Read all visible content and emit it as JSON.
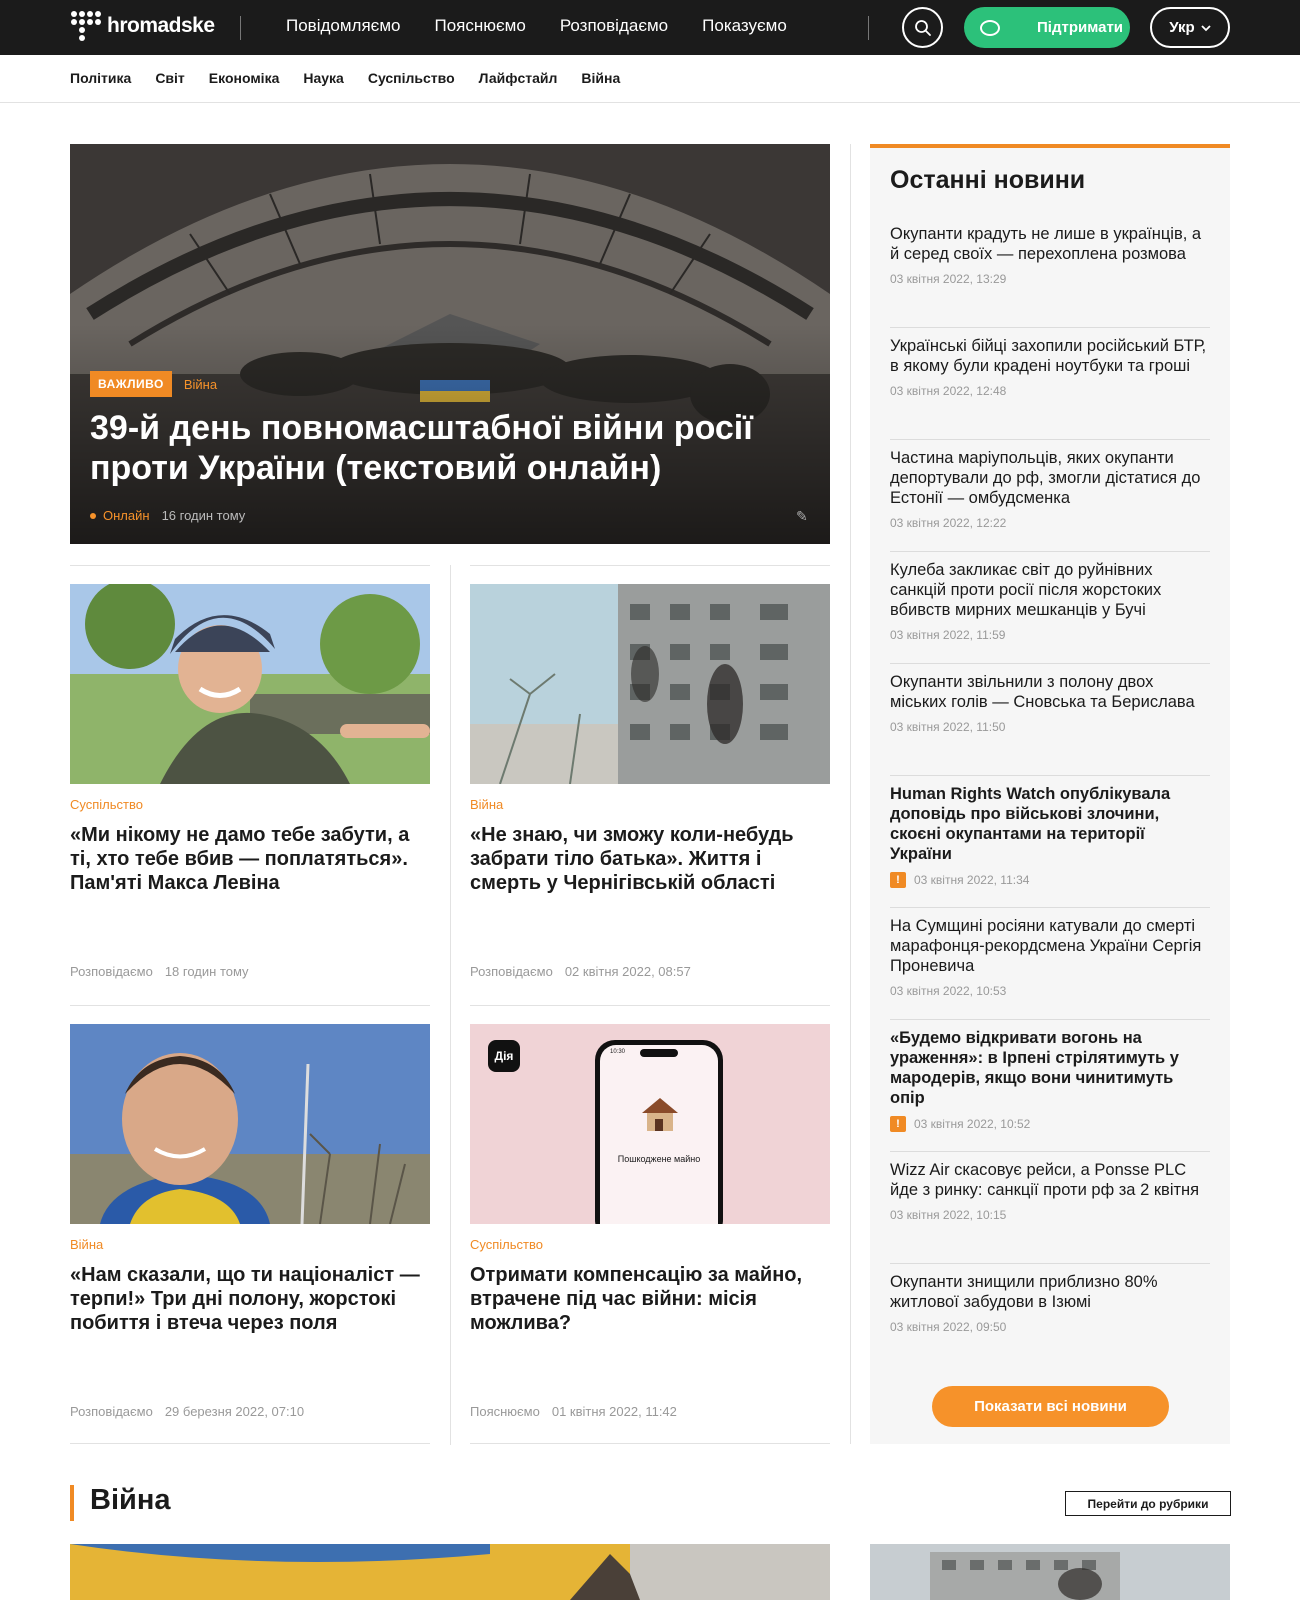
{
  "header": {
    "logo_text": "hromadske",
    "nav": [
      "Повідомляємо",
      "Пояснюємо",
      "Розповідаємо",
      "Показуємо"
    ],
    "support_label": "Підтримати",
    "lang_label": "Укр"
  },
  "subnav": [
    "Політика",
    "Світ",
    "Економіка",
    "Наука",
    "Суспільство",
    "Лайфстайл",
    "Війна"
  ],
  "hero": {
    "badge": "ВАЖЛИВО",
    "category": "Війна",
    "title": "39-й день повномасштабної війни росії проти України (текстовий онлайн)",
    "live_label": "Онлайн",
    "time": "16 годин тому"
  },
  "cards": [
    {
      "category": "Суспільство",
      "title": "«Ми нікому не дамо тебе забути, а ті, хто тебе вбив — поплатяться». Пам'яті Макса Левіна",
      "section": "Розповідаємо",
      "time": "18 годин тому"
    },
    {
      "category": "Війна",
      "title": "«Не знаю, чи зможу коли-небудь забрати тіло батька». Життя і смерть у Чернігівській області",
      "section": "Розповідаємо",
      "time": "02 квітня 2022, 08:57"
    },
    {
      "category": "Війна",
      "title": "«Нам сказали, що ти націоналіст — терпи!» Три дні полону, жорстокі побиття і втеча через поля",
      "section": "Розповідаємо",
      "time": "29 березня 2022, 07:10"
    },
    {
      "category": "Суспільство",
      "title": "Отримати компенсацію за майно, втрачене під час війни: місія можлива?",
      "section": "Пояснюємо",
      "time": "01 квітня 2022, 11:42"
    }
  ],
  "diia": {
    "app_label": "Дія",
    "screen_text": "Пошкоджене майно",
    "phone_time": "10:30"
  },
  "sidebar": {
    "title": "Останні новини",
    "items": [
      {
        "title": "Окупанти крадуть не лише в українців, а й серед своїх — перехоплена розмова",
        "date": "03 квітня 2022, 13:29",
        "bold": false,
        "important": false
      },
      {
        "title": "Українські бійці захопили російський БТР, в якому були крадені ноутбуки та гроші",
        "date": "03 квітня 2022, 12:48",
        "bold": false,
        "important": false
      },
      {
        "title": "Частина маріупольців, яких окупанти депортували до рф, змогли дістатися до Естонії — омбудсменка",
        "date": "03 квітня 2022, 12:22",
        "bold": false,
        "important": false
      },
      {
        "title": "Кулеба закликає світ до руйнівних санкцій проти росії після жорстоких вбивств мирних мешканців у Бучі",
        "date": "03 квітня 2022, 11:59",
        "bold": false,
        "important": false
      },
      {
        "title": "Окупанти звільнили з полону двох міських голів — Сновська та Берислава",
        "date": "03 квітня 2022, 11:50",
        "bold": false,
        "important": false
      },
      {
        "title": "Human Rights Watch опублікувала доповідь про військові злочини, скоєні окупантами на території України",
        "date": "03 квітня 2022, 11:34",
        "bold": true,
        "important": true
      },
      {
        "title": "На Сумщині росіяни катували до смерті марафонця-рекордсмена України Сергія Проневича",
        "date": "03 квітня 2022, 10:53",
        "bold": false,
        "important": false
      },
      {
        "title": "«Будемо відкривати вогонь на ураження»: в Ірпені стрілятимуть у мародерів, якщо вони чинитимуть опір",
        "date": "03 квітня 2022, 10:52",
        "bold": true,
        "important": true
      },
      {
        "title": "Wizz Air скасовує рейси, а Ponsse PLC йде з ринку: санкції проти рф за 2 квітня",
        "date": "03 квітня 2022, 10:15",
        "bold": false,
        "important": false
      },
      {
        "title": "Окупанти знищили приблизно 80% житлової забудови в Ізюмі",
        "date": "03 квітня 2022, 09:50",
        "bold": false,
        "important": false
      }
    ],
    "show_all": "Показати всі новини",
    "important_mark": "!"
  },
  "section": {
    "title": "Війна",
    "link": "Перейти до рубрики"
  },
  "colors": {
    "accent": "#f08a24",
    "dark": "#1b1b1b",
    "support": "#2cc17a"
  }
}
